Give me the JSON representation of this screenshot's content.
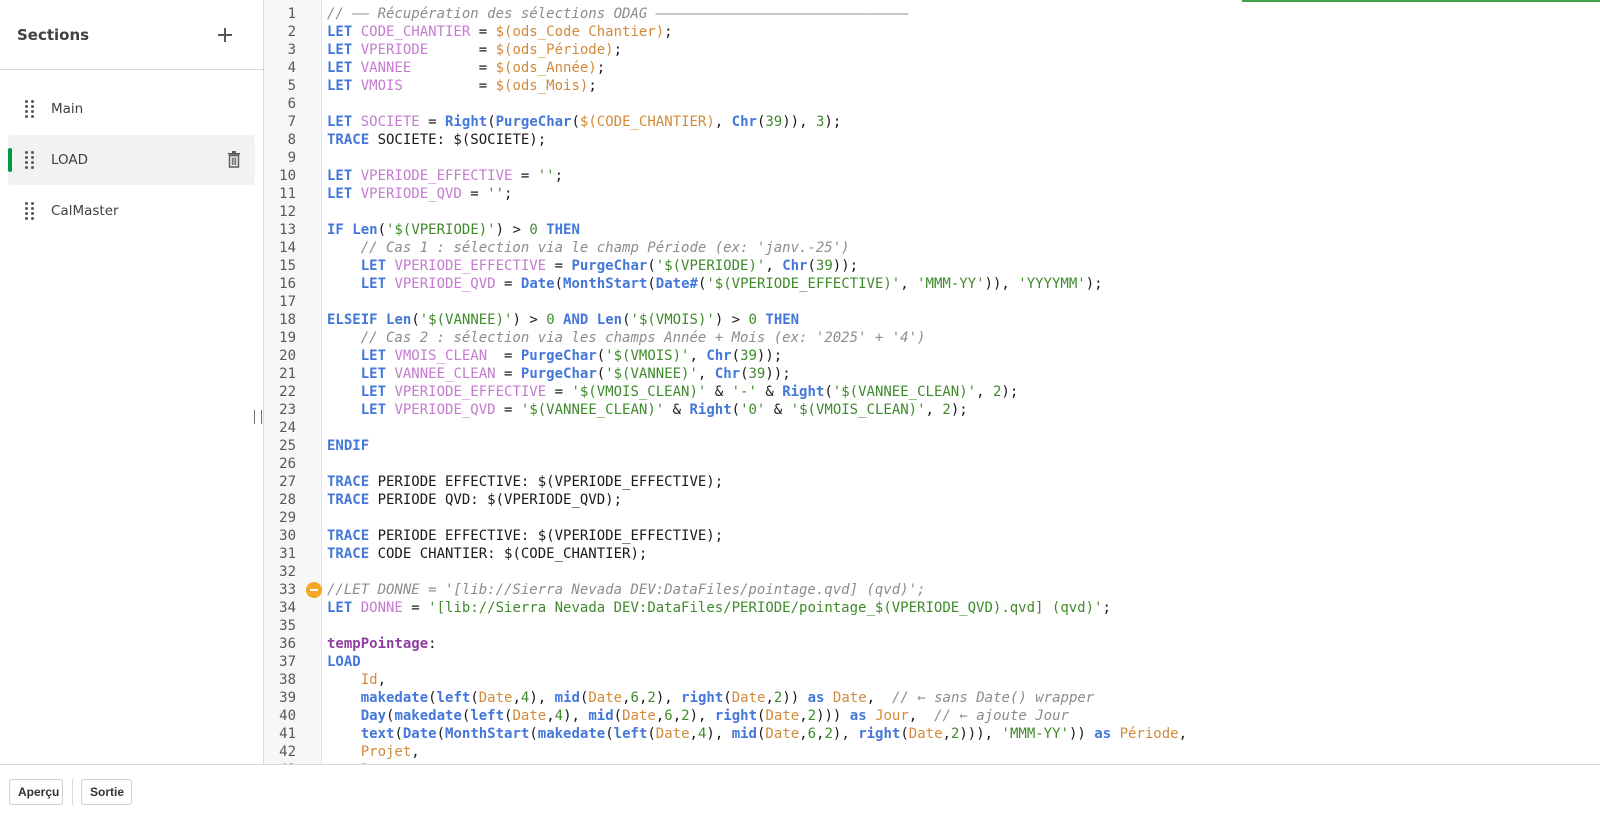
{
  "sidebar": {
    "title": "Sections",
    "add_icon": "plus-icon",
    "items": [
      {
        "label": "Main",
        "active": false
      },
      {
        "label": "LOAD",
        "active": true
      },
      {
        "label": "CalMaster",
        "active": false
      }
    ],
    "accent_color": "#009845"
  },
  "editor": {
    "breakpoint_line": 33,
    "lines": [
      [
        [
          "cmt",
          "// —— Récupération des sélections ODAG ——————————————————————————————"
        ]
      ],
      [
        [
          "kw",
          "LET "
        ],
        [
          "var",
          "CODE_CHANTIER"
        ],
        [
          "txt",
          " = "
        ],
        [
          "dol",
          "$(ods_Code Chantier)"
        ],
        [
          "txt",
          ";"
        ]
      ],
      [
        [
          "kw",
          "LET "
        ],
        [
          "var",
          "VPERIODE"
        ],
        [
          "txt",
          "      = "
        ],
        [
          "dol",
          "$(ods_Période)"
        ],
        [
          "txt",
          ";"
        ]
      ],
      [
        [
          "kw",
          "LET "
        ],
        [
          "var",
          "VANNEE"
        ],
        [
          "txt",
          "        = "
        ],
        [
          "dol",
          "$(ods_Année)"
        ],
        [
          "txt",
          ";"
        ]
      ],
      [
        [
          "kw",
          "LET "
        ],
        [
          "var",
          "VMOIS"
        ],
        [
          "txt",
          "         = "
        ],
        [
          "dol",
          "$(ods_Mois)"
        ],
        [
          "txt",
          ";"
        ]
      ],
      [],
      [
        [
          "kw",
          "LET "
        ],
        [
          "var",
          "SOCIETE"
        ],
        [
          "txt",
          " = "
        ],
        [
          "fn",
          "Right"
        ],
        [
          "txt",
          "("
        ],
        [
          "fn",
          "PurgeChar"
        ],
        [
          "txt",
          "("
        ],
        [
          "dol",
          "$(CODE_CHANTIER)"
        ],
        [
          "txt",
          ", "
        ],
        [
          "fn",
          "Chr"
        ],
        [
          "txt",
          "("
        ],
        [
          "num",
          "39"
        ],
        [
          "txt",
          ")), "
        ],
        [
          "num",
          "3"
        ],
        [
          "txt",
          ");"
        ]
      ],
      [
        [
          "kw",
          "TRACE "
        ],
        [
          "txt",
          "SOCIETE: $(SOCIETE);"
        ]
      ],
      [],
      [
        [
          "kw",
          "LET "
        ],
        [
          "var",
          "VPERIODE_EFFECTIVE"
        ],
        [
          "txt",
          " = "
        ],
        [
          "str",
          "''"
        ],
        [
          "txt",
          ";"
        ]
      ],
      [
        [
          "kw",
          "LET "
        ],
        [
          "var",
          "VPERIODE_QVD"
        ],
        [
          "txt",
          " = "
        ],
        [
          "str",
          "''"
        ],
        [
          "txt",
          ";"
        ]
      ],
      [],
      [
        [
          "kw",
          "IF "
        ],
        [
          "fn",
          "Len"
        ],
        [
          "txt",
          "("
        ],
        [
          "str",
          "'$(VPERIODE)'"
        ],
        [
          "txt",
          ") > "
        ],
        [
          "num",
          "0"
        ],
        [
          "kw",
          " THEN"
        ]
      ],
      [
        [
          "txt",
          "    "
        ],
        [
          "cmt",
          "// Cas 1 : sélection via le champ Période (ex: 'janv.-25')"
        ]
      ],
      [
        [
          "txt",
          "    "
        ],
        [
          "kw",
          "LET "
        ],
        [
          "var",
          "VPERIODE_EFFECTIVE"
        ],
        [
          "txt",
          " = "
        ],
        [
          "fn",
          "PurgeChar"
        ],
        [
          "txt",
          "("
        ],
        [
          "str",
          "'$(VPERIODE)'"
        ],
        [
          "txt",
          ", "
        ],
        [
          "fn",
          "Chr"
        ],
        [
          "txt",
          "("
        ],
        [
          "num",
          "39"
        ],
        [
          "txt",
          "));"
        ]
      ],
      [
        [
          "txt",
          "    "
        ],
        [
          "kw",
          "LET "
        ],
        [
          "var",
          "VPERIODE_QVD"
        ],
        [
          "txt",
          " = "
        ],
        [
          "fn",
          "Date"
        ],
        [
          "txt",
          "("
        ],
        [
          "fn",
          "MonthStart"
        ],
        [
          "txt",
          "("
        ],
        [
          "fn",
          "Date#"
        ],
        [
          "txt",
          "("
        ],
        [
          "str",
          "'$(VPERIODE_EFFECTIVE)'"
        ],
        [
          "txt",
          ", "
        ],
        [
          "str",
          "'MMM-YY'"
        ],
        [
          "txt",
          ")), "
        ],
        [
          "str",
          "'YYYYMM'"
        ],
        [
          "txt",
          ");"
        ]
      ],
      [],
      [
        [
          "kw",
          "ELSEIF "
        ],
        [
          "fn",
          "Len"
        ],
        [
          "txt",
          "("
        ],
        [
          "str",
          "'$(VANNEE)'"
        ],
        [
          "txt",
          ") > "
        ],
        [
          "num",
          "0"
        ],
        [
          "kw",
          " AND "
        ],
        [
          "fn",
          "Len"
        ],
        [
          "txt",
          "("
        ],
        [
          "str",
          "'$(VMOIS)'"
        ],
        [
          "txt",
          ") > "
        ],
        [
          "num",
          "0"
        ],
        [
          "kw",
          " THEN"
        ]
      ],
      [
        [
          "txt",
          "    "
        ],
        [
          "cmt",
          "// Cas 2 : sélection via les champs Année + Mois (ex: '2025' + '4')"
        ]
      ],
      [
        [
          "txt",
          "    "
        ],
        [
          "kw",
          "LET "
        ],
        [
          "var",
          "VMOIS_CLEAN"
        ],
        [
          "txt",
          "  = "
        ],
        [
          "fn",
          "PurgeChar"
        ],
        [
          "txt",
          "("
        ],
        [
          "str",
          "'$(VMOIS)'"
        ],
        [
          "txt",
          ", "
        ],
        [
          "fn",
          "Chr"
        ],
        [
          "txt",
          "("
        ],
        [
          "num",
          "39"
        ],
        [
          "txt",
          "));"
        ]
      ],
      [
        [
          "txt",
          "    "
        ],
        [
          "kw",
          "LET "
        ],
        [
          "var",
          "VANNEE_CLEAN"
        ],
        [
          "txt",
          " = "
        ],
        [
          "fn",
          "PurgeChar"
        ],
        [
          "txt",
          "("
        ],
        [
          "str",
          "'$(VANNEE)'"
        ],
        [
          "txt",
          ", "
        ],
        [
          "fn",
          "Chr"
        ],
        [
          "txt",
          "("
        ],
        [
          "num",
          "39"
        ],
        [
          "txt",
          "));"
        ]
      ],
      [
        [
          "txt",
          "    "
        ],
        [
          "kw",
          "LET "
        ],
        [
          "var",
          "VPERIODE_EFFECTIVE"
        ],
        [
          "txt",
          " = "
        ],
        [
          "str",
          "'$(VMOIS_CLEAN)'"
        ],
        [
          "txt",
          " & "
        ],
        [
          "str",
          "'-'"
        ],
        [
          "txt",
          " & "
        ],
        [
          "fn",
          "Right"
        ],
        [
          "txt",
          "("
        ],
        [
          "str",
          "'$(VANNEE_CLEAN)'"
        ],
        [
          "txt",
          ", "
        ],
        [
          "num",
          "2"
        ],
        [
          "txt",
          ");"
        ]
      ],
      [
        [
          "txt",
          "    "
        ],
        [
          "kw",
          "LET "
        ],
        [
          "var",
          "VPERIODE_QVD"
        ],
        [
          "txt",
          " = "
        ],
        [
          "str",
          "'$(VANNEE_CLEAN)'"
        ],
        [
          "txt",
          " & "
        ],
        [
          "fn",
          "Right"
        ],
        [
          "txt",
          "("
        ],
        [
          "str",
          "'0'"
        ],
        [
          "txt",
          " & "
        ],
        [
          "str",
          "'$(VMOIS_CLEAN)'"
        ],
        [
          "txt",
          ", "
        ],
        [
          "num",
          "2"
        ],
        [
          "txt",
          ");"
        ]
      ],
      [],
      [
        [
          "kw",
          "ENDIF"
        ]
      ],
      [],
      [
        [
          "kw",
          "TRACE "
        ],
        [
          "txt",
          "PERIODE EFFECTIVE: $(VPERIODE_EFFECTIVE);"
        ]
      ],
      [
        [
          "kw",
          "TRACE "
        ],
        [
          "txt",
          "PERIODE QVD: $(VPERIODE_QVD);"
        ]
      ],
      [],
      [
        [
          "kw",
          "TRACE "
        ],
        [
          "txt",
          "PERIODE EFFECTIVE: $(VPERIODE_EFFECTIVE);"
        ]
      ],
      [
        [
          "kw",
          "TRACE "
        ],
        [
          "txt",
          "CODE CHANTIER: $(CODE_CHANTIER);"
        ]
      ],
      [],
      [
        [
          "cmt",
          "//LET DONNE = '[lib://Sierra Nevada DEV:DataFiles/pointage.qvd] (qvd)';"
        ]
      ],
      [
        [
          "kw",
          "LET "
        ],
        [
          "var",
          "DONNE"
        ],
        [
          "txt",
          " = "
        ],
        [
          "str",
          "'[lib://Sierra Nevada DEV:DataFiles/PERIODE/pointage_$(VPERIODE_QVD).qvd] (qvd)'"
        ],
        [
          "txt",
          ";"
        ]
      ],
      [],
      [
        [
          "lbl",
          "tempPointage"
        ],
        [
          "txt",
          ":"
        ]
      ],
      [
        [
          "kw",
          "LOAD"
        ]
      ],
      [
        [
          "txt",
          "    "
        ],
        [
          "fld",
          "Id"
        ],
        [
          "txt",
          ","
        ]
      ],
      [
        [
          "txt",
          "    "
        ],
        [
          "fn",
          "makedate"
        ],
        [
          "txt",
          "("
        ],
        [
          "fn",
          "left"
        ],
        [
          "txt",
          "("
        ],
        [
          "fld",
          "Date"
        ],
        [
          "txt",
          ","
        ],
        [
          "num",
          "4"
        ],
        [
          "txt",
          "), "
        ],
        [
          "fn",
          "mid"
        ],
        [
          "txt",
          "("
        ],
        [
          "fld",
          "Date"
        ],
        [
          "txt",
          ","
        ],
        [
          "num",
          "6"
        ],
        [
          "txt",
          ","
        ],
        [
          "num",
          "2"
        ],
        [
          "txt",
          "), "
        ],
        [
          "fn",
          "right"
        ],
        [
          "txt",
          "("
        ],
        [
          "fld",
          "Date"
        ],
        [
          "txt",
          ","
        ],
        [
          "num",
          "2"
        ],
        [
          "txt",
          ")) "
        ],
        [
          "kw",
          "as "
        ],
        [
          "fld",
          "Date"
        ],
        [
          "txt",
          ",  "
        ],
        [
          "cmt",
          "// ← sans Date() wrapper"
        ]
      ],
      [
        [
          "txt",
          "    "
        ],
        [
          "fn",
          "Day"
        ],
        [
          "txt",
          "("
        ],
        [
          "fn",
          "makedate"
        ],
        [
          "txt",
          "("
        ],
        [
          "fn",
          "left"
        ],
        [
          "txt",
          "("
        ],
        [
          "fld",
          "Date"
        ],
        [
          "txt",
          ","
        ],
        [
          "num",
          "4"
        ],
        [
          "txt",
          "), "
        ],
        [
          "fn",
          "mid"
        ],
        [
          "txt",
          "("
        ],
        [
          "fld",
          "Date"
        ],
        [
          "txt",
          ","
        ],
        [
          "num",
          "6"
        ],
        [
          "txt",
          ","
        ],
        [
          "num",
          "2"
        ],
        [
          "txt",
          "), "
        ],
        [
          "fn",
          "right"
        ],
        [
          "txt",
          "("
        ],
        [
          "fld",
          "Date"
        ],
        [
          "txt",
          ","
        ],
        [
          "num",
          "2"
        ],
        [
          "txt",
          "))) "
        ],
        [
          "kw",
          "as "
        ],
        [
          "fld",
          "Jour"
        ],
        [
          "txt",
          ",  "
        ],
        [
          "cmt",
          "// ← ajoute Jour"
        ]
      ],
      [
        [
          "txt",
          "    "
        ],
        [
          "fn",
          "text"
        ],
        [
          "txt",
          "("
        ],
        [
          "fn",
          "Date"
        ],
        [
          "txt",
          "("
        ],
        [
          "fn",
          "MonthStart"
        ],
        [
          "txt",
          "("
        ],
        [
          "fn",
          "makedate"
        ],
        [
          "txt",
          "("
        ],
        [
          "fn",
          "left"
        ],
        [
          "txt",
          "("
        ],
        [
          "fld",
          "Date"
        ],
        [
          "txt",
          ","
        ],
        [
          "num",
          "4"
        ],
        [
          "txt",
          "), "
        ],
        [
          "fn",
          "mid"
        ],
        [
          "txt",
          "("
        ],
        [
          "fld",
          "Date"
        ],
        [
          "txt",
          ","
        ],
        [
          "num",
          "6"
        ],
        [
          "txt",
          ","
        ],
        [
          "num",
          "2"
        ],
        [
          "txt",
          "), "
        ],
        [
          "fn",
          "right"
        ],
        [
          "txt",
          "("
        ],
        [
          "fld",
          "Date"
        ],
        [
          "txt",
          ","
        ],
        [
          "num",
          "2"
        ],
        [
          "txt",
          "))), "
        ],
        [
          "str",
          "'MMM-YY'"
        ],
        [
          "txt",
          ")) "
        ],
        [
          "kw",
          "as "
        ],
        [
          "fld",
          "Période"
        ],
        [
          "txt",
          ","
        ]
      ],
      [
        [
          "txt",
          "    "
        ],
        [
          "fld",
          "Projet"
        ],
        [
          "txt",
          ","
        ]
      ],
      [
        [
          "txt",
          "    "
        ],
        [
          "fld",
          "Poste"
        ],
        [
          "txt",
          ","
        ]
      ]
    ]
  },
  "bottom_bar": {
    "preview_label": "Aperçu",
    "output_label": "Sortie"
  }
}
